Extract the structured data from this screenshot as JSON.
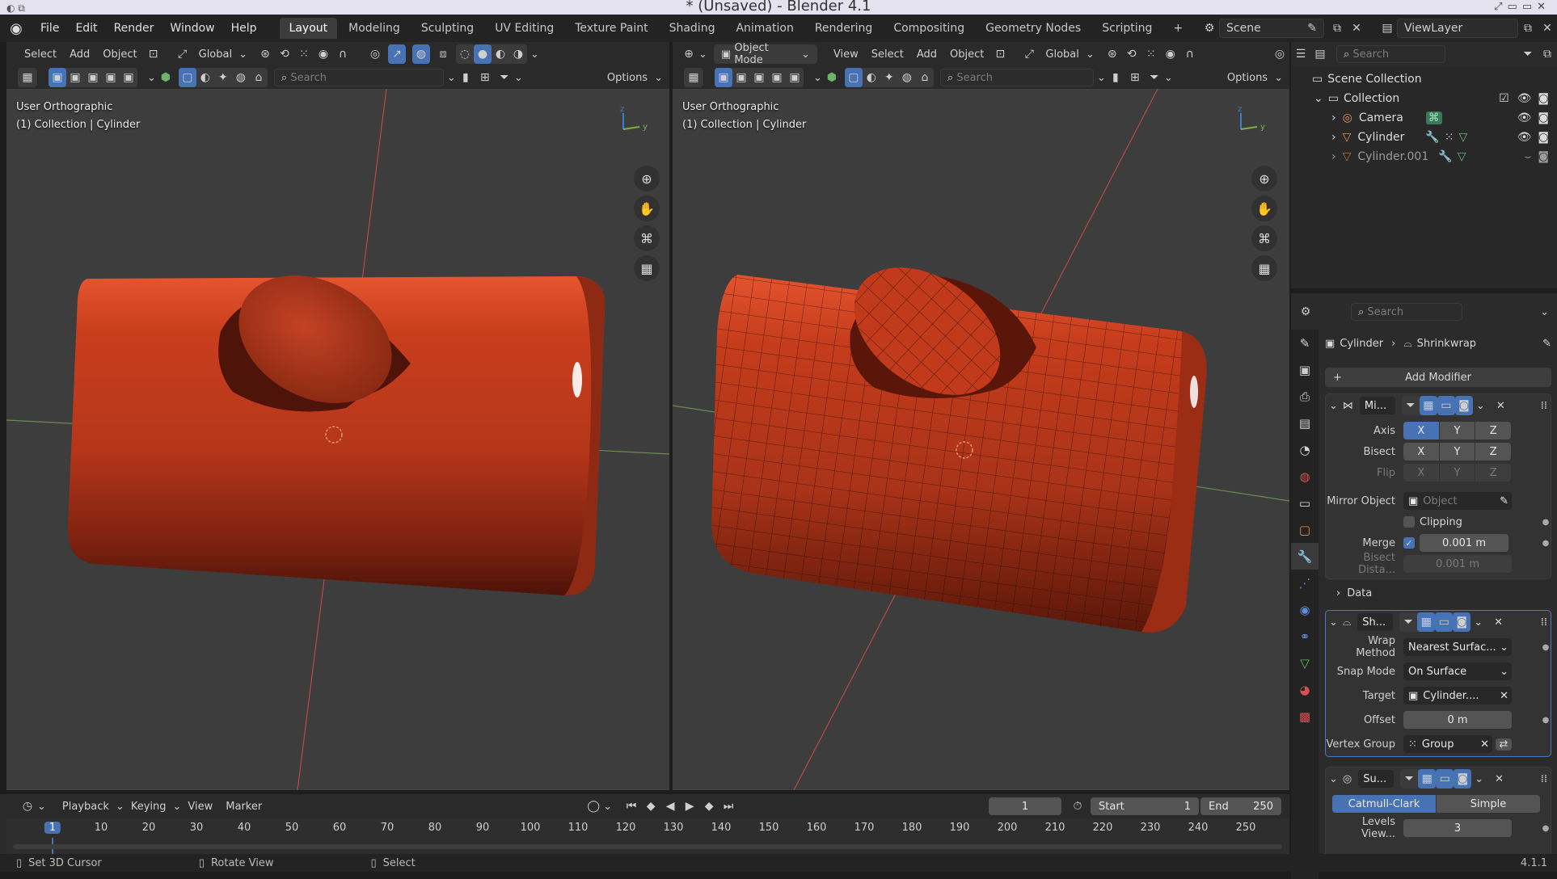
{
  "window": {
    "title": "* (Unsaved) - Blender 4.1"
  },
  "menu": [
    "File",
    "Edit",
    "Render",
    "Window",
    "Help"
  ],
  "workspaces": [
    "Layout",
    "Modeling",
    "Sculpting",
    "UV Editing",
    "Texture Paint",
    "Shading",
    "Animation",
    "Rendering",
    "Compositing",
    "Geometry Nodes",
    "Scripting"
  ],
  "active_workspace": "Layout",
  "scene": {
    "label": "Scene",
    "view_layer": "ViewLayer"
  },
  "viewport_left": {
    "menus": [
      "Select",
      "Add",
      "Object"
    ],
    "orientation": "Global",
    "search_placeholder": "Search",
    "options": "Options",
    "info_line1": "User Orthographic",
    "info_line2": "(1) Collection | Cylinder"
  },
  "viewport_right": {
    "mode": "Object Mode",
    "menus": [
      "View",
      "Select",
      "Add",
      "Object"
    ],
    "orientation": "Global",
    "search_placeholder": "Search",
    "options": "Options",
    "info_line1": "User Orthographic",
    "info_line2": "(1) Collection | Cylinder"
  },
  "axes": {
    "z": "z",
    "y": "y"
  },
  "outliner": {
    "search_placeholder": "Search",
    "scene_collection": "Scene Collection",
    "collection": "Collection",
    "items": [
      "Camera",
      "Cylinder",
      "Cylinder.001"
    ]
  },
  "properties": {
    "search_placeholder": "Search",
    "breadcrumb_object": "Cylinder",
    "breadcrumb_modifier": "Shrinkwrap",
    "add_modifier": "Add Modifier",
    "mirror": {
      "name": "Mi...",
      "axis_label": "Axis",
      "bisect_label": "Bisect",
      "flip_label": "Flip",
      "xyz": [
        "X",
        "Y",
        "Z"
      ],
      "mirror_object_label": "Mirror Object",
      "mirror_object_placeholder": "Object",
      "clipping_label": "Clipping",
      "merge_label": "Merge",
      "merge_value": "0.001 m",
      "bisect_distance_label": "Bisect Dista...",
      "bisect_distance_value": "0.001 m",
      "data_label": "Data"
    },
    "shrinkwrap": {
      "name": "Sh...",
      "wrap_method_label": "Wrap Method",
      "wrap_method_value": "Nearest Surfac...",
      "snap_mode_label": "Snap Mode",
      "snap_mode_value": "On Surface",
      "target_label": "Target",
      "target_value": "Cylinder....",
      "offset_label": "Offset",
      "offset_value": "0 m",
      "vertex_group_label": "Vertex Group",
      "vertex_group_value": "Group"
    },
    "subsurf": {
      "name": "Su...",
      "catmull": "Catmull-Clark",
      "simple": "Simple",
      "levels_label": "Levels View...",
      "levels_value": "3"
    }
  },
  "timeline": {
    "menus": [
      "Playback",
      "Keying",
      "View",
      "Marker"
    ],
    "current_frame": "1",
    "start_label": "Start",
    "start_value": "1",
    "end_label": "End",
    "end_value": "250",
    "ticks": [
      "1",
      "10",
      "20",
      "30",
      "40",
      "50",
      "60",
      "70",
      "80",
      "90",
      "100",
      "110",
      "120",
      "130",
      "140",
      "150",
      "160",
      "170",
      "180",
      "190",
      "200",
      "210",
      "220",
      "230",
      "240",
      "250"
    ]
  },
  "status": {
    "set_cursor": "Set 3D Cursor",
    "rotate": "Rotate View",
    "select": "Select",
    "version": "4.1.1"
  },
  "colors": {
    "accent": "#4772b3",
    "object": "#b83a1f",
    "x_axis": "#c44a4a",
    "y_axis": "#7ab34a"
  }
}
